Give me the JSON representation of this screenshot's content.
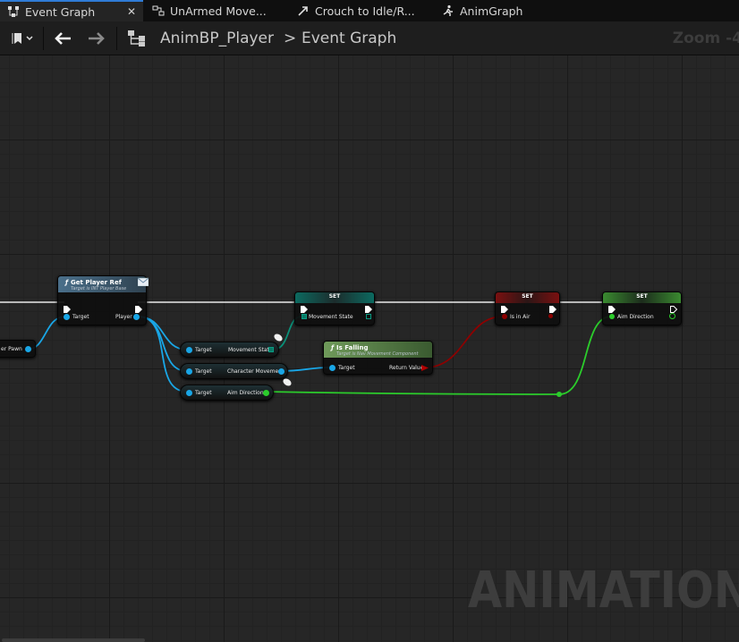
{
  "tabs": [
    {
      "label": "Event Graph",
      "icon": "graph-icon",
      "active": true,
      "close": "✕"
    },
    {
      "label": "UnArmed Move...",
      "icon": "state-machine-icon"
    },
    {
      "label": "Crouch to Idle/R...",
      "icon": "transition-icon"
    },
    {
      "label": "AnimGraph",
      "icon": "anim-graph-icon"
    }
  ],
  "toolbar": {
    "breadcrumb_root": "AnimBP_Player",
    "breadcrumb_sep": ">",
    "breadcrumb_current": "Event Graph",
    "zoom": "Zoom -4"
  },
  "graph": {
    "edge_node": {
      "pin": "er Pawn"
    },
    "get_player_ref": {
      "title": "Get Player Ref",
      "subtitle": "Target is INT Player Base",
      "pin_target": "Target",
      "pin_player": "Player"
    },
    "get_movement_state": {
      "pin_target": "Target",
      "pin_value": "Movement State"
    },
    "get_char_movement": {
      "pin_target": "Target",
      "pin_value": "Character Movement"
    },
    "get_aim_direction": {
      "pin_target": "Target",
      "pin_value": "Aim Direction"
    },
    "set_movement_state": {
      "title": "SET",
      "pin": "Movement State"
    },
    "is_falling": {
      "title": "Is Falling",
      "subtitle": "Target is Nav Movement Component",
      "pin_target": "Target",
      "pin_return": "Return Value"
    },
    "set_in_air": {
      "title": "SET",
      "pin": "Is in Air"
    },
    "set_aim_direction": {
      "title": "SET",
      "pin": "Aim Direction"
    },
    "watermark": "ANIMATION"
  },
  "colors": {
    "object_pin": "#19a6e6",
    "bool_pin": "#8c0000",
    "vector_pin": "#2bcc2b",
    "enum_pin": "#0a7a66",
    "function_header": "#4a6f8a",
    "accent": "#2f7bd6"
  }
}
